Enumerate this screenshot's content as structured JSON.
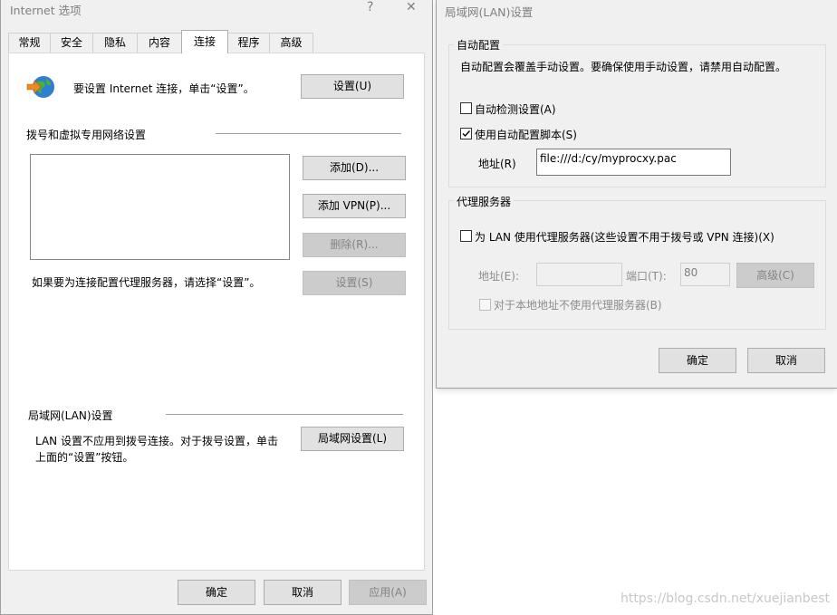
{
  "internet_options": {
    "title": "Internet 选项",
    "help_glyph": "?",
    "close_glyph": "✕",
    "tabs": [
      "常规",
      "安全",
      "隐私",
      "内容",
      "连接",
      "程序",
      "高级"
    ],
    "active_tab": "连接",
    "setup_text": "要设置 Internet 连接，单击“设置”。",
    "setup_button": "设置(U)",
    "dialup_section": "拨号和虚拟专用网络设置",
    "add_button": "添加(D)...",
    "add_vpn_button": "添加 VPN(P)...",
    "remove_button": "删除(R)...",
    "proxy_hint": "如果要为连接配置代理服务器，请选择“设置”。",
    "settings_button": "设置(S)",
    "lan_section": "局域网(LAN)设置",
    "lan_desc_line1": "LAN 设置不应用到拨号连接。对于拨号设置，单击",
    "lan_desc_line2": "上面的“设置”按钮。",
    "lan_button": "局域网设置(L)",
    "ok_button": "确定",
    "cancel_button": "取消",
    "apply_button": "应用(A)"
  },
  "lan_dialog": {
    "title": "局域网(LAN)设置",
    "auto_config_group": "自动配置",
    "auto_config_desc": "自动配置会覆盖手动设置。要确保使用手动设置，请禁用自动配置。",
    "auto_detect_label": "自动检测设置(A)",
    "auto_detect_checked": false,
    "use_script_label": "使用自动配置脚本(S)",
    "use_script_checked": true,
    "address_label": "地址(R)",
    "address_value": "file:///d:/cy/myprocxy.pac",
    "proxy_group": "代理服务器",
    "use_proxy_label": "为 LAN 使用代理服务器(这些设置不用于拨号或 VPN 连接)(X)",
    "use_proxy_checked": false,
    "proxy_address_label": "地址(E):",
    "proxy_address_value": "",
    "port_label": "端口(T):",
    "port_value": "80",
    "advanced_button": "高级(C)",
    "bypass_local_label": "对于本地地址不使用代理服务器(B)",
    "bypass_local_checked": false,
    "ok_button": "确定",
    "cancel_button": "取消"
  },
  "watermark": "https://blog.csdn.net/xuejianbest"
}
